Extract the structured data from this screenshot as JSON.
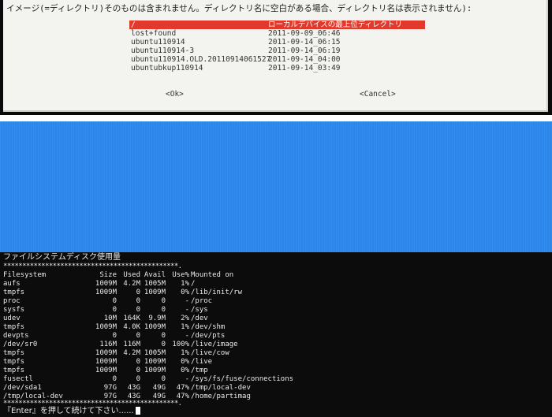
{
  "dialog": {
    "text": "イメージ(=ディレクトリ)そのものは含まれません。ディレクトリ名に空白がある場合、ディレクトリ名は表示されません):",
    "directories": [
      {
        "name": "/",
        "date": "ローカルデバイスの最上位ディレクトリ",
        "selected": true
      },
      {
        "name": "lost+found",
        "date": "2011-09-09_06:46"
      },
      {
        "name": "ubuntu110914",
        "date": "2011-09-14_06:15"
      },
      {
        "name": "ubuntu110914-3",
        "date": "2011-09-14_06:19"
      },
      {
        "name": "ubuntu110914.OLD.20110914061527",
        "date": "2011-09-14_04:00"
      },
      {
        "name": "ubuntubkup110914",
        "date": "2011-09-14_03:49"
      }
    ],
    "ok_label": "<Ok>",
    "cancel_label": "<Cancel>"
  },
  "colors": {
    "dialog_bg": "#f3f3ef",
    "selection": "#e13a2c",
    "band": "#2a86ea",
    "terminal_bg": "#0c0c0c"
  },
  "terminal": {
    "title": "ファイルシステムディスク使用量",
    "separator": "**********************************************.",
    "separator_end": "**********************************************.",
    "header": {
      "fs": "Filesystem",
      "size": "Size",
      "used": "Used",
      "avail": "Avail",
      "use": "Use%",
      "mounted": "Mounted on"
    },
    "rows": [
      {
        "fs": "aufs",
        "size": "1009M",
        "used": "4.2M",
        "avail": "1005M",
        "use": "1%",
        "mounted": "/"
      },
      {
        "fs": "tmpfs",
        "size": "1009M",
        "used": "0",
        "avail": "1009M",
        "use": "0%",
        "mounted": "/lib/init/rw"
      },
      {
        "fs": "proc",
        "size": "0",
        "used": "0",
        "avail": "0",
        "use": "-",
        "mounted": "/proc"
      },
      {
        "fs": "sysfs",
        "size": "0",
        "used": "0",
        "avail": "0",
        "use": "-",
        "mounted": "/sys"
      },
      {
        "fs": "udev",
        "size": "10M",
        "used": "164K",
        "avail": "9.9M",
        "use": "2%",
        "mounted": "/dev"
      },
      {
        "fs": "tmpfs",
        "size": "1009M",
        "used": "4.0K",
        "avail": "1009M",
        "use": "1%",
        "mounted": "/dev/shm"
      },
      {
        "fs": "devpts",
        "size": "0",
        "used": "0",
        "avail": "0",
        "use": "-",
        "mounted": "/dev/pts"
      },
      {
        "fs": "/dev/sr0",
        "size": "116M",
        "used": "116M",
        "avail": "0",
        "use": "100%",
        "mounted": "/live/image"
      },
      {
        "fs": "tmpfs",
        "size": "1009M",
        "used": "4.2M",
        "avail": "1005M",
        "use": "1%",
        "mounted": "/live/cow"
      },
      {
        "fs": "tmpfs",
        "size": "1009M",
        "used": "0",
        "avail": "1009M",
        "use": "0%",
        "mounted": "/live"
      },
      {
        "fs": "tmpfs",
        "size": "1009M",
        "used": "0",
        "avail": "1009M",
        "use": "0%",
        "mounted": "/tmp"
      },
      {
        "fs": "fusectl",
        "size": "0",
        "used": "0",
        "avail": "0",
        "use": "-",
        "mounted": "/sys/fs/fuse/connections"
      },
      {
        "fs": "/dev/sda1",
        "size": "97G",
        "used": "43G",
        "avail": "49G",
        "use": "47%",
        "mounted": "/tmp/local-dev"
      },
      {
        "fs": "/tmp/local-dev",
        "size": "97G",
        "used": "43G",
        "avail": "49G",
        "use": "47%",
        "mounted": "/home/partimag"
      }
    ],
    "prompt": "『Enter』を押して続けて下さい......"
  }
}
